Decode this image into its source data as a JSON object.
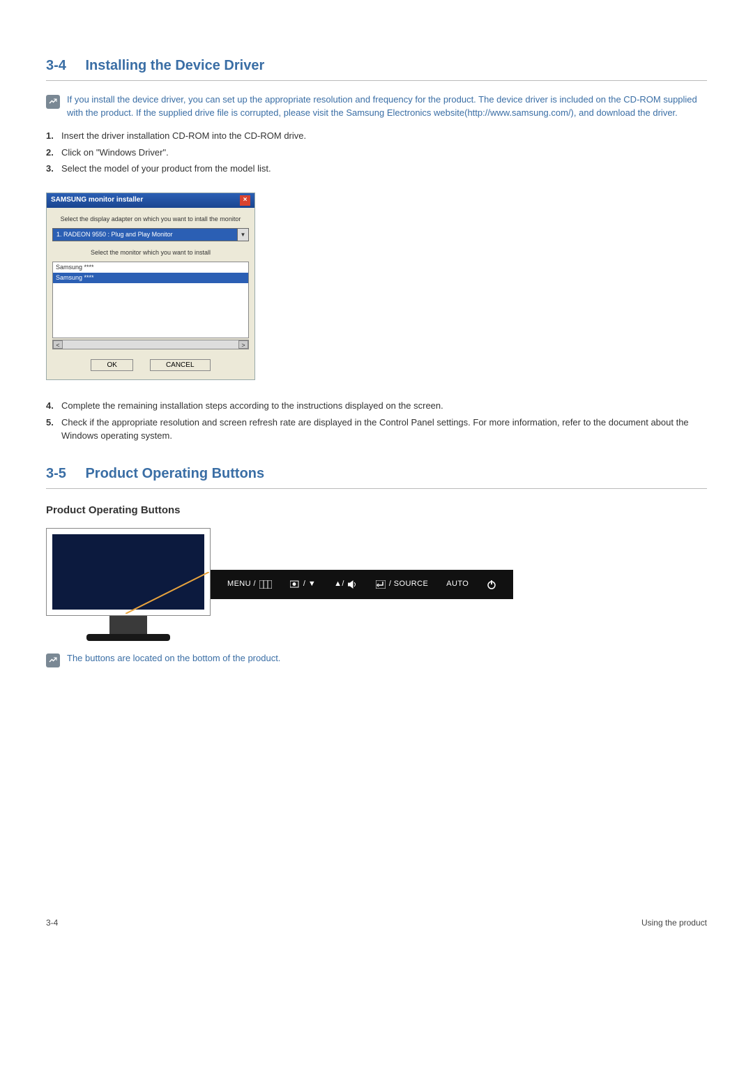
{
  "sections": {
    "s34": {
      "num": "3-4",
      "title": "Installing the Device Driver",
      "note": "If you install the device driver, you can set up the appropriate resolution and frequency for the product. The device driver is included on the CD-ROM supplied with the product. If the supplied drive file is corrupted, please visit the Samsung Electronics website(http://www.samsung.com/), and download the driver.",
      "steps_a": [
        "Insert the driver installation CD-ROM into the CD-ROM drive.",
        "Click on \"Windows Driver\".",
        "Select the model of your product from the model list."
      ],
      "steps_b": [
        "Complete the remaining installation steps according to the instructions displayed on the screen.",
        "Check if the appropriate resolution and screen refresh rate are displayed in the Control Panel settings. For more information, refer to the document about the Windows operating system."
      ]
    },
    "s35": {
      "num": "3-5",
      "title": "Product Operating Buttons",
      "sub": "Product Operating Buttons",
      "note": "The buttons are located on the bottom of the product."
    }
  },
  "dialog": {
    "title": "SAMSUNG monitor installer",
    "label1": "Select the display adapter on which you want to intall the monitor",
    "dropdown": "1. RADEON 9550 : Plug and Play Monitor",
    "label2": "Select the monitor which you want to install",
    "list": [
      "Samsung ****",
      "Samsung ****"
    ],
    "ok": "OK",
    "cancel": "CANCEL"
  },
  "strip": {
    "menu": "MENU /",
    "source": "/ SOURCE",
    "auto": "AUTO"
  },
  "footer": {
    "left": "3-4",
    "right": "Using the product"
  }
}
